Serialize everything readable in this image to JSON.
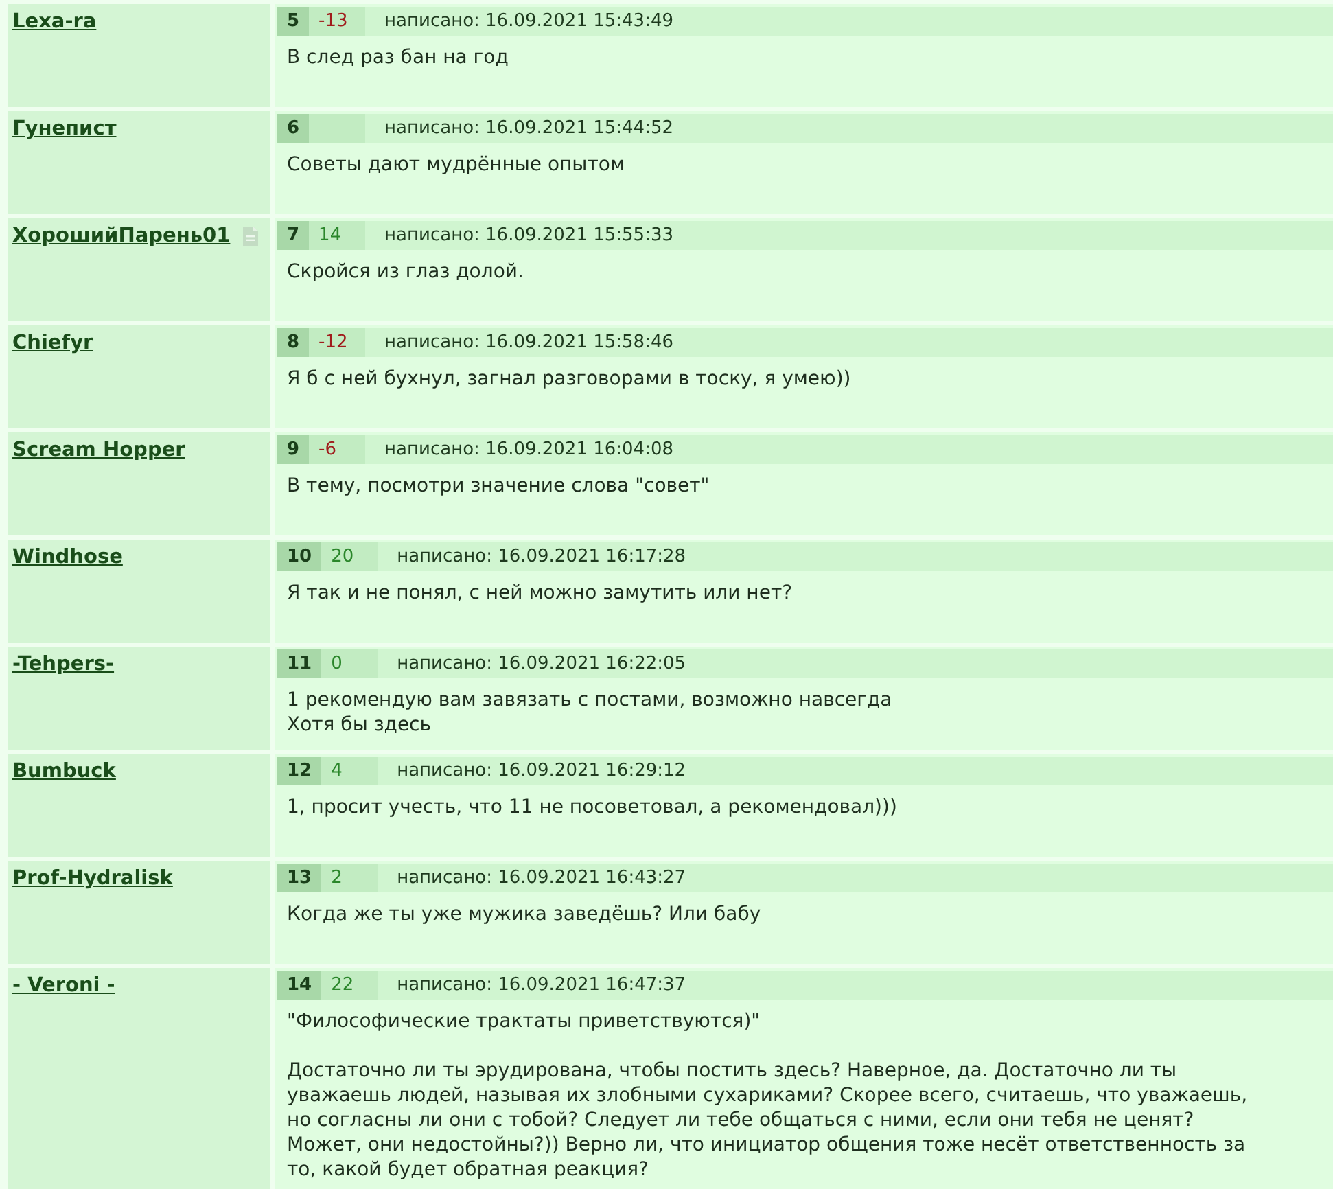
{
  "posts": [
    {
      "author": "Lexa-ra",
      "note_icon": false,
      "number": "5",
      "rating": {
        "text": "-13",
        "color": "#a01c1c"
      },
      "date": "написано: 16.09.2021 15:43:49",
      "text": "В след раз бан на год"
    },
    {
      "author": "Гунепист",
      "note_icon": false,
      "number": "6",
      "date": "написано: 16.09.2021 15:44:52",
      "text": "Советы дают мудрённые опытом"
    },
    {
      "author": "ХорошийПарень01",
      "note_icon": true,
      "number": "7",
      "rating": {
        "text": "14",
        "color": "#2a862a"
      },
      "date": "написано: 16.09.2021 15:55:33",
      "text": "Скройся из глаз долой."
    },
    {
      "author": "Chiefyr",
      "note_icon": false,
      "number": "8",
      "rating": {
        "text": "-12",
        "color": "#a01c1c"
      },
      "date": "написано: 16.09.2021 15:58:46",
      "text": "Я б с ней бухнул, загнал разговорами в тоску, я умею))"
    },
    {
      "author": "Scream Hopper",
      "note_icon": false,
      "number": "9",
      "rating": {
        "text": "-6",
        "color": "#a01c1c"
      },
      "date": "написано: 16.09.2021 16:04:08",
      "text": "В тему, посмотри значение слова \"совет\""
    },
    {
      "author": "Windhose",
      "note_icon": false,
      "number": "10",
      "rating": {
        "text": "20",
        "color": "#2a862a"
      },
      "date": "написано: 16.09.2021 16:17:28",
      "text": "Я так и не понял, с ней можно замутить или нет?"
    },
    {
      "author": "-Tehpers-",
      "note_icon": false,
      "number": "11",
      "rating": {
        "text": "0",
        "color": "#2a862a"
      },
      "date": "написано: 16.09.2021 16:22:05",
      "text": "1 рекомендую вам завязать с постами, возможно навсегда\nХотя бы здесь"
    },
    {
      "author": "Bumbuck",
      "note_icon": false,
      "number": "12",
      "rating": {
        "text": "4",
        "color": "#2a862a"
      },
      "date": "написано: 16.09.2021 16:29:12",
      "text": "1, просит учесть, что 11 не посоветовал, а рекомендовал)))"
    },
    {
      "author": "Prof-Hydralisk",
      "note_icon": false,
      "number": "13",
      "rating": {
        "text": "2",
        "color": "#2a862a"
      },
      "date": "написано: 16.09.2021 16:43:27",
      "text": "Когда же ты уже мужика заведёшь? Или бабу"
    },
    {
      "author": "- Veroni -",
      "note_icon": false,
      "number": "14",
      "rating": {
        "text": "22",
        "color": "#2a862a"
      },
      "date": "написано: 16.09.2021 16:47:37",
      "text": "\"Философические трактаты приветствуются)\"\n\nДостаточно ли ты эрудирована, чтобы постить здесь? Наверное, да. Достаточно ли ты\nуважаешь людей, называя их злобными сухариками? Скорее всего, считаешь, что уважаешь,\nно согласны ли они с тобой? Следует ли тебе общаться с ними, если они тебя не ценят?\nМожет, они недостойны?)) Верно ли, что инициатор общения тоже несёт ответственность за\nто, какой будет обратная реакция?"
    }
  ]
}
